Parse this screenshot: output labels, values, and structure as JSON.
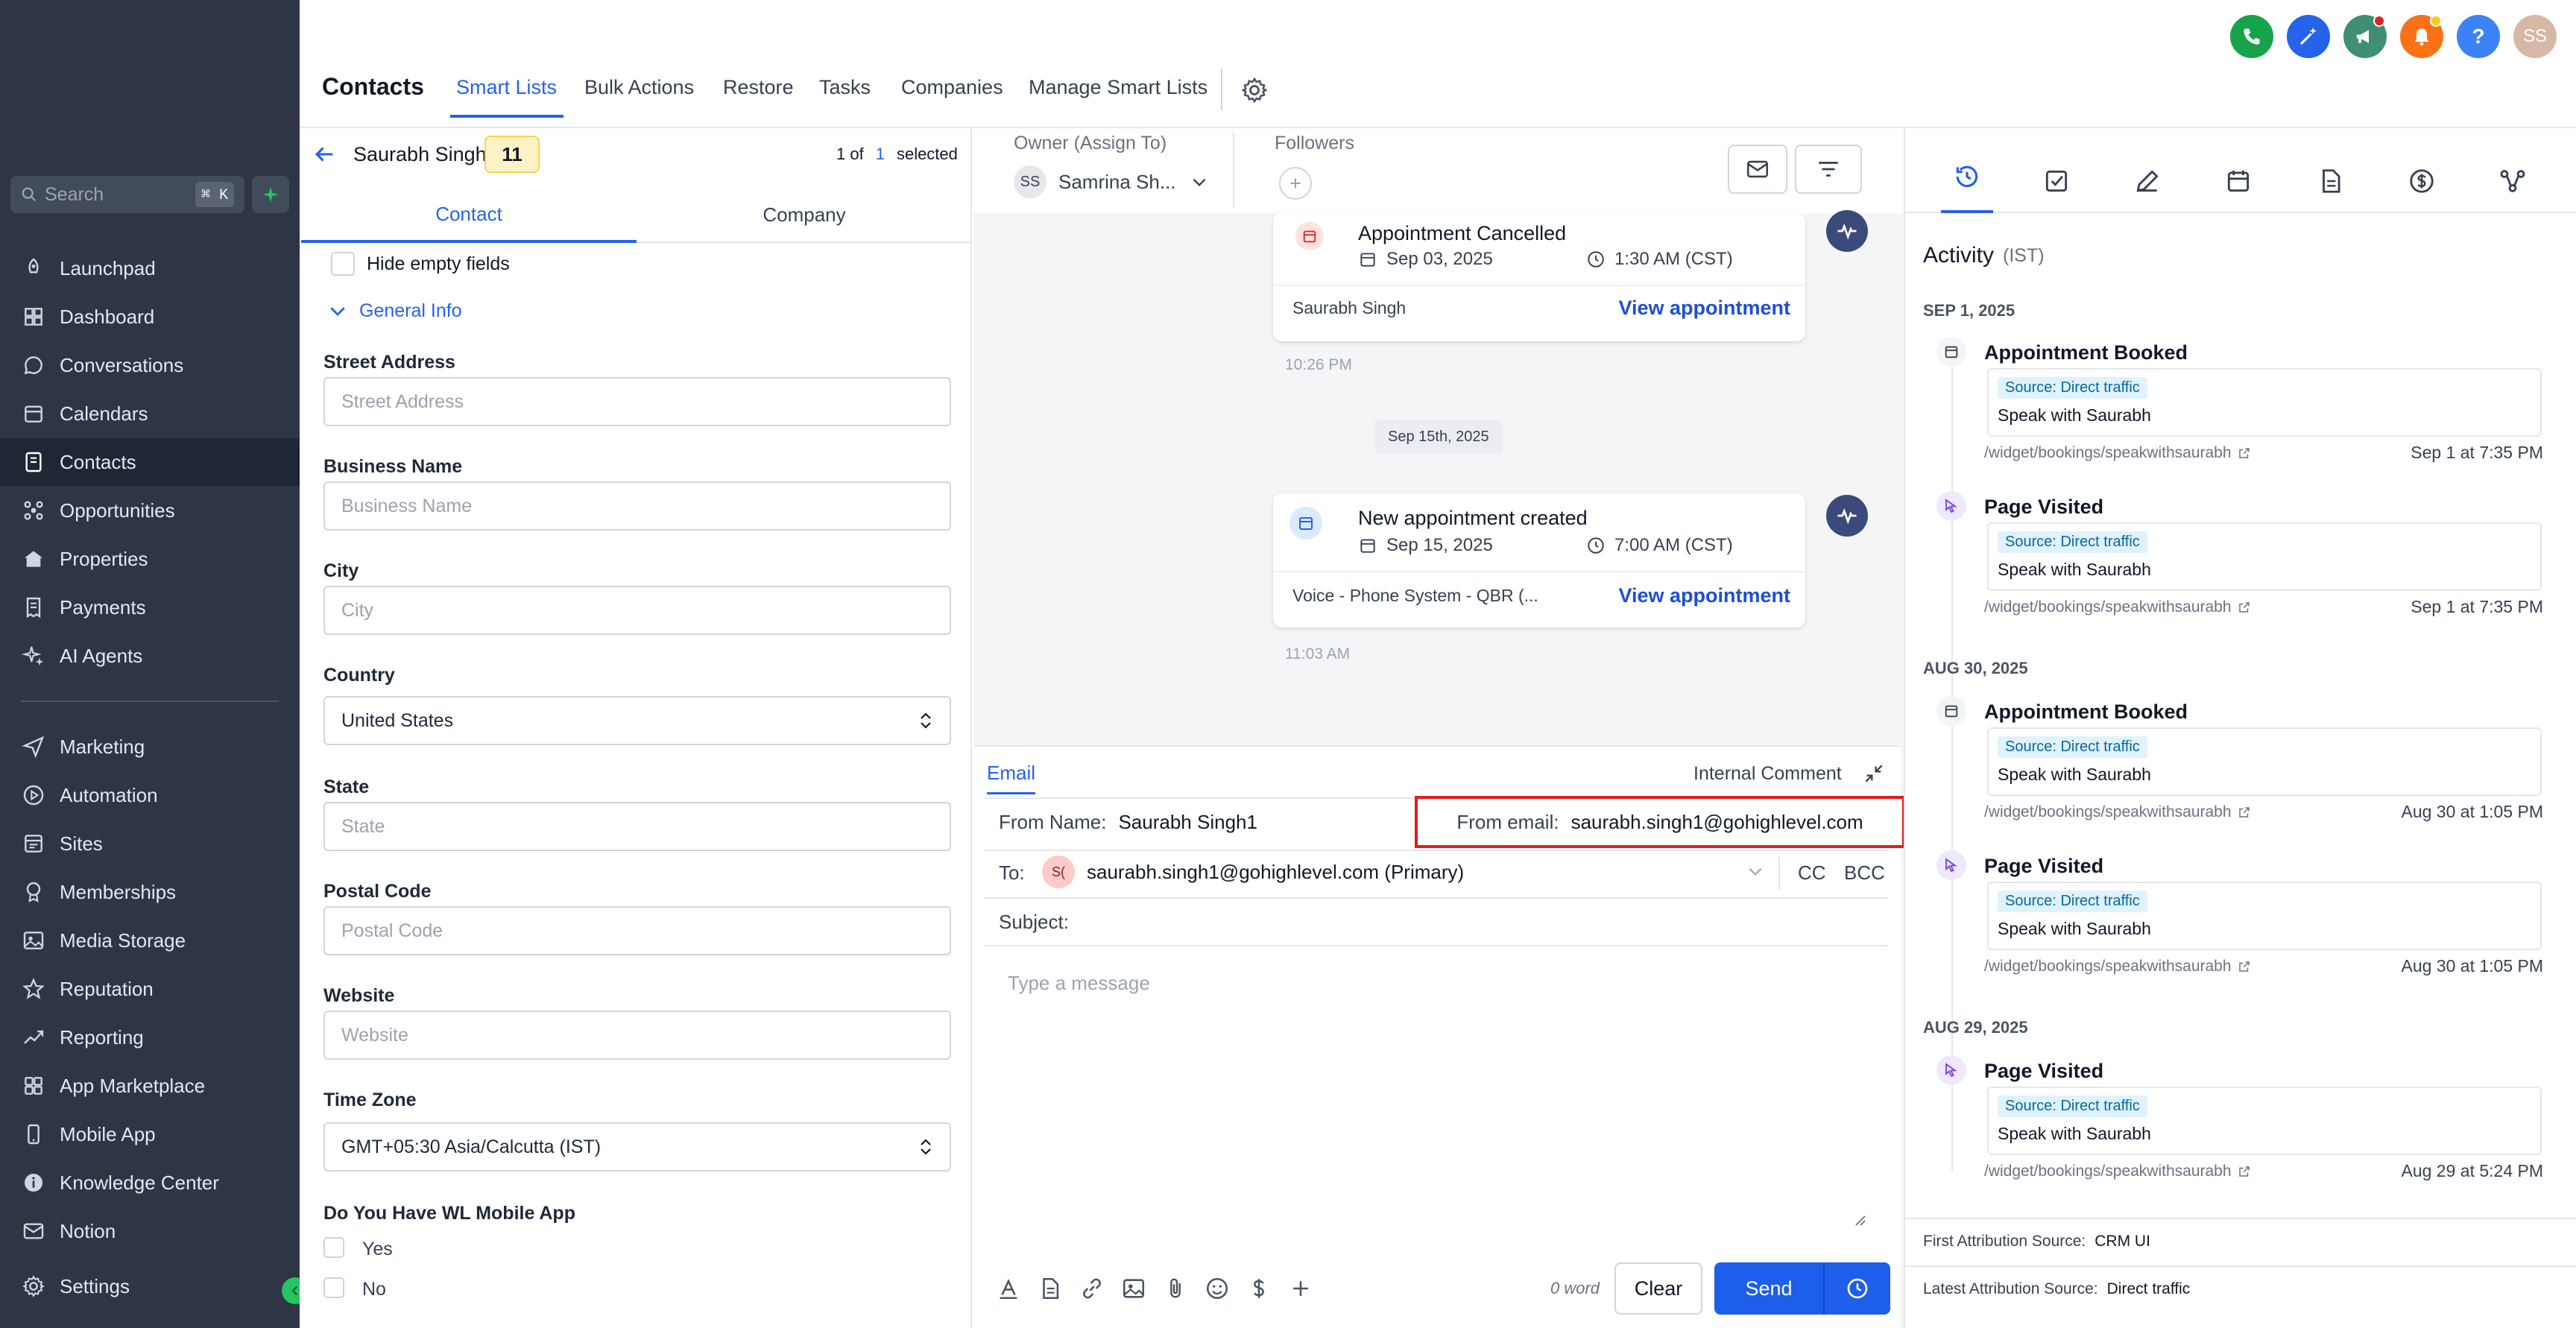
{
  "header": {
    "title": "Contacts",
    "tabs": [
      "Smart Lists",
      "Bulk Actions",
      "Restore",
      "Tasks",
      "Companies",
      "Manage Smart Lists"
    ],
    "avatar": "SS",
    "help": "?"
  },
  "sidebar": {
    "search_placeholder": "Search",
    "search_shortcut": "⌘ K",
    "items": [
      {
        "label": "Launchpad",
        "icon": "rocket-icon"
      },
      {
        "label": "Dashboard",
        "icon": "dashboard-icon"
      },
      {
        "label": "Conversations",
        "icon": "chat-icon"
      },
      {
        "label": "Calendars",
        "icon": "calendar-icon"
      },
      {
        "label": "Contacts",
        "icon": "contacts-icon"
      },
      {
        "label": "Opportunities",
        "icon": "opportunities-icon"
      },
      {
        "label": "Properties",
        "icon": "home-icon"
      },
      {
        "label": "Payments",
        "icon": "receipt-icon"
      },
      {
        "label": "AI Agents",
        "icon": "sparkle-icon"
      },
      {
        "label": "Marketing",
        "icon": "send-icon"
      },
      {
        "label": "Automation",
        "icon": "automation-icon"
      },
      {
        "label": "Sites",
        "icon": "sites-icon"
      },
      {
        "label": "Memberships",
        "icon": "award-icon"
      },
      {
        "label": "Media Storage",
        "icon": "image-icon"
      },
      {
        "label": "Reputation",
        "icon": "star-icon"
      },
      {
        "label": "Reporting",
        "icon": "trend-icon"
      },
      {
        "label": "App Marketplace",
        "icon": "grid-icon"
      },
      {
        "label": "Mobile App",
        "icon": "phone-icon"
      },
      {
        "label": "Knowledge Center",
        "icon": "info-icon"
      },
      {
        "label": "Notion",
        "icon": "mail-icon"
      },
      {
        "label": "Settings",
        "icon": "gear-icon"
      }
    ]
  },
  "contact": {
    "name": "Saurabh Singh",
    "count": "11",
    "pager_prefix": "1 of",
    "pager_num": "1",
    "pager_suffix": "selected",
    "tabs": [
      "Contact",
      "Company"
    ],
    "hide_empty": "Hide empty fields",
    "section": "General Info",
    "fields": [
      {
        "label": "Street Address",
        "placeholder": "Street Address",
        "value": ""
      },
      {
        "label": "Business Name",
        "placeholder": "Business Name",
        "value": ""
      },
      {
        "label": "City",
        "placeholder": "City",
        "value": ""
      },
      {
        "label": "Country",
        "placeholder": "",
        "value": "United States"
      },
      {
        "label": "State",
        "placeholder": "State",
        "value": ""
      },
      {
        "label": "Postal Code",
        "placeholder": "Postal Code",
        "value": ""
      },
      {
        "label": "Website",
        "placeholder": "Website",
        "value": ""
      },
      {
        "label": "Time Zone",
        "placeholder": "",
        "value": "GMT+05:30 Asia/Calcutta (IST)"
      }
    ],
    "wl_label": "Do You Have WL Mobile App",
    "wl_options": [
      "Yes",
      "No"
    ]
  },
  "conversation": {
    "owner_label": "Owner (Assign To)",
    "owner_initials": "SS",
    "owner_name": "Samrina Sh...",
    "followers_label": "Followers",
    "cards": [
      {
        "title": "Appointment Cancelled",
        "date": "Sep 03, 2025",
        "time": "1:30 AM (CST)",
        "who": "Saurabh Singh",
        "link": "View appointment",
        "stamp": "10:26 PM"
      },
      {
        "title": "New appointment created",
        "date": "Sep 15, 2025",
        "time": "7:00 AM (CST)",
        "who": "Voice - Phone System - QBR (...",
        "link": "View appointment",
        "stamp": "11:03 AM"
      }
    ],
    "date_chip": "Sep 15th, 2025"
  },
  "composer": {
    "tab_email": "Email",
    "tab_internal": "Internal Comment",
    "from_name_label": "From Name:",
    "from_name": "Saurabh Singh1",
    "from_email_label": "From email:",
    "from_email": "saurabh.singh1@gohighlevel.com",
    "to_label": "To:",
    "to_initials": "S(",
    "to_value": "saurabh.singh1@gohighlevel.com (Primary)",
    "cc": "CC",
    "bcc": "BCC",
    "subject_label": "Subject:",
    "message_placeholder": "Type a message",
    "word_count": "0 word",
    "clear": "Clear",
    "send": "Send"
  },
  "activity": {
    "title": "Activity",
    "tz": "(IST)",
    "groups": [
      {
        "date": "SEP 1, 2025",
        "items": [
          {
            "title": "Appointment Booked",
            "icon": "calendar",
            "badge": "Source: Direct traffic",
            "desc": "Speak with Saurabh",
            "url": "/widget/bookings/speakwithsaurabh",
            "time": "Sep 1 at 7:35 PM"
          },
          {
            "title": "Page Visited",
            "icon": "cursor",
            "badge": "Source: Direct traffic",
            "desc": "Speak with Saurabh",
            "url": "/widget/bookings/speakwithsaurabh",
            "time": "Sep 1 at 7:35 PM"
          }
        ]
      },
      {
        "date": "AUG 30, 2025",
        "items": [
          {
            "title": "Appointment Booked",
            "icon": "calendar",
            "badge": "Source: Direct traffic",
            "desc": "Speak with Saurabh",
            "url": "/widget/bookings/speakwithsaurabh",
            "time": "Aug 30 at 1:05 PM"
          },
          {
            "title": "Page Visited",
            "icon": "cursor",
            "badge": "Source: Direct traffic",
            "desc": "Speak with Saurabh",
            "url": "/widget/bookings/speakwithsaurabh",
            "time": "Aug 30 at 1:05 PM"
          }
        ]
      },
      {
        "date": "AUG 29, 2025",
        "items": [
          {
            "title": "Page Visited",
            "icon": "cursor",
            "badge": "Source: Direct traffic",
            "desc": "Speak with Saurabh",
            "url": "/widget/bookings/speakwithsaurabh",
            "time": "Aug 29 at 5:24 PM"
          }
        ]
      }
    ],
    "first_attr_label": "First Attribution Source:",
    "first_attr_value": "CRM UI",
    "latest_attr_label": "Latest Attribution Source:",
    "latest_attr_value": "Direct traffic"
  },
  "colors": {
    "accent": "#2563eb",
    "sidebar": "#2e3646",
    "highlight": "#e11d1d",
    "phone": "#16a34a",
    "bell": "#f97316"
  }
}
